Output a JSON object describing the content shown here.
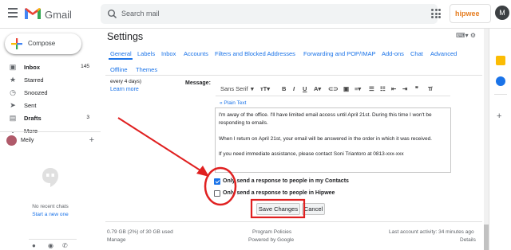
{
  "header": {
    "app_name": "Gmail",
    "search_placeholder": "Search mail",
    "brand_label": "hipwee",
    "avatar_initial": "M"
  },
  "sidebar": {
    "compose_label": "Compose",
    "items": [
      {
        "label": "Inbox",
        "count": "145",
        "icon": "inbox-icon",
        "bold": true
      },
      {
        "label": "Starred",
        "count": "",
        "icon": "star-icon"
      },
      {
        "label": "Snoozed",
        "count": "",
        "icon": "clock-icon"
      },
      {
        "label": "Sent",
        "count": "",
        "icon": "send-icon"
      },
      {
        "label": "Drafts",
        "count": "3",
        "icon": "draft-icon",
        "bold": true
      },
      {
        "label": "More",
        "count": "",
        "icon": "chevron-down-icon"
      }
    ],
    "user_name": "Meily",
    "no_chats": "No recent chats",
    "start_new": "Start a new one"
  },
  "settings": {
    "title": "Settings",
    "tabs_row1": [
      "General",
      "Labels",
      "Inbox",
      "Accounts",
      "Filters and Blocked Addresses",
      "Forwarding and POP/IMAP",
      "Add-ons",
      "Chat",
      "Advanced"
    ],
    "tabs_row2": [
      "Offline",
      "Themes"
    ],
    "left_note": "every 4 days)",
    "learn_more": "Learn more",
    "message_label": "Message:",
    "font_select": "Sans Serif",
    "plain_text_link": "« Plain Text",
    "body_lines": [
      "I'm away of the office. I'll have limited email access until April 21st. During this time I won't be responding to emails.",
      "When I return on April 21st, your email will be answered in the order in which it was received.",
      "If you need immediate assistance, please contact Soni Triantoro at 0813-xxx-xxx"
    ],
    "option_contacts": "Only send a response to people in my Contacts",
    "option_contacts_checked": true,
    "option_domain": "Only send a response to people in Hipwee",
    "option_domain_checked": false,
    "save_label": "Save Changes",
    "cancel_label": "Cancel"
  },
  "footer": {
    "storage": "0.79 GB (2%) of 30 GB used",
    "manage": "Manage",
    "policies": "Program Policies",
    "powered": "Powered by Google",
    "activity": "Last account activity: 34 minutes ago",
    "details": "Details"
  },
  "colors": {
    "accent": "#1a73e8",
    "annotation": "#e02020",
    "gmail_red": "#ea4335"
  }
}
